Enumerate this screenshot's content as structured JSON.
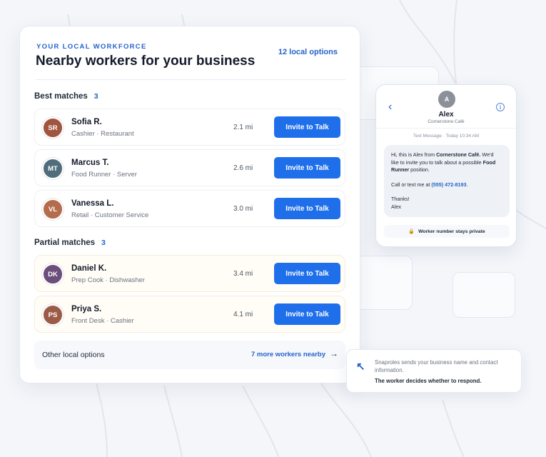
{
  "header": {
    "eyebrow": "YOUR LOCAL WORKFORCE",
    "title": "Nearby workers for your business",
    "local_options": "12 local options"
  },
  "best_matches": {
    "title": "Best matches",
    "count": "3",
    "workers": [
      {
        "initials": "SR",
        "name": "Sofia R.",
        "roles": "Cashier · Restaurant",
        "distance": "2.1 mi",
        "invite_label": "Invite to Talk",
        "avatar_color": "#a0553f"
      },
      {
        "initials": "MT",
        "name": "Marcus T.",
        "roles": "Food Runner · Server",
        "distance": "2.6 mi",
        "invite_label": "Invite to Talk",
        "avatar_color": "#4f6d7a"
      },
      {
        "initials": "VL",
        "name": "Vanessa L.",
        "roles": "Retail · Customer Service",
        "distance": "3.0 mi",
        "invite_label": "Invite to Talk",
        "avatar_color": "#b46c4d"
      }
    ]
  },
  "partial_matches": {
    "title": "Partial matches",
    "count": "3",
    "workers": [
      {
        "initials": "DK",
        "name": "Daniel K.",
        "roles": "Prep Cook · Dishwasher",
        "distance": "3.4 mi",
        "invite_label": "Invite to Talk",
        "avatar_color": "#6b4f7a"
      },
      {
        "initials": "PS",
        "name": "Priya S.",
        "roles": "Front Desk · Cashier",
        "distance": "4.1 mi",
        "invite_label": "Invite to Talk",
        "avatar_color": "#9b5b45"
      }
    ]
  },
  "other": {
    "label": "Other local options",
    "link": "7 more workers nearby",
    "arrow": "→"
  },
  "phone": {
    "avatar_initial": "A",
    "name": "Alex",
    "business": "Cornerstone Café",
    "meta": "Text Message · Today 10:34 AM",
    "msg_intro": "Hi, this is Alex from ",
    "msg_business": "Cornerstone Café.",
    "msg_mid": " We'd like to invite you to talk about a possible ",
    "msg_position": "Food Runner",
    "msg_end": " position.",
    "msg_call": "Call or text me at ",
    "msg_phone": "(555) 472-8193",
    "msg_call_end": ".",
    "msg_thanks": "Thanks!",
    "msg_sign": "Alex",
    "privacy": "Worker number stays private",
    "back_glyph": "‹",
    "info_glyph": "i",
    "lock_glyph": "🔒"
  },
  "note": {
    "text": "Snaproles sends your business name and contact information.",
    "strong": "The worker decides whether to respond."
  },
  "colors": {
    "accent": "#1f6feb",
    "link": "#2563c9"
  }
}
